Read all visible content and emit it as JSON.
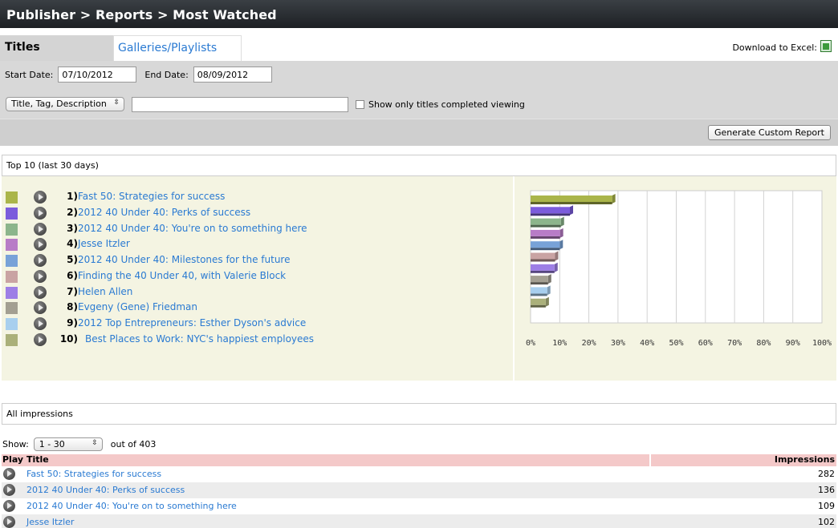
{
  "header": {
    "breadcrumb": "Publisher > Reports > Most Watched"
  },
  "tabs": {
    "titles": "Titles",
    "galleries": "Galleries/Playlists",
    "download_label": "Download to Excel:"
  },
  "filters": {
    "start_label": "Start Date:",
    "start_value": "07/10/2012",
    "end_label": "End Date:",
    "end_value": "08/09/2012",
    "search_field_select": "Title, Tag, Description",
    "search_value": "",
    "completed_label": "Show only titles completed viewing",
    "completed_checked": false,
    "generate_label": "Generate Custom Report"
  },
  "top10": {
    "heading": "Top 10 (last 30 days)",
    "items": [
      {
        "rank": "1)",
        "title": "Fast 50: Strategies for success",
        "color": "#aab54a"
      },
      {
        "rank": "2)",
        "title": "2012 40 Under 40: Perks of success",
        "color": "#7b5cdc"
      },
      {
        "rank": "3)",
        "title": "2012 40 Under 40: You're on to something here",
        "color": "#8cb58c"
      },
      {
        "rank": "4)",
        "title": "Jesse Itzler",
        "color": "#b87cc7"
      },
      {
        "rank": "5)",
        "title": "2012 40 Under 40: Milestones for the future",
        "color": "#78a2d8"
      },
      {
        "rank": "6)",
        "title": "Finding the 40 Under 40, with Valerie Block",
        "color": "#c9a3a3"
      },
      {
        "rank": "7)",
        "title": "Helen Allen",
        "color": "#9d7ee6"
      },
      {
        "rank": "8)",
        "title": "Evgeny (Gene) Friedman",
        "color": "#a39f92"
      },
      {
        "rank": "9)",
        "title": "2012 Top Entrepreneurs: Esther Dyson's advice",
        "color": "#a8cfee"
      },
      {
        "rank": "10)",
        "title": "Best Places to Work: NYC's happiest employees",
        "color": "#aab07a"
      }
    ]
  },
  "chart_data": {
    "type": "bar",
    "orientation": "horizontal",
    "categories": [
      "Fast 50: Strategies for success",
      "2012 40 Under 40: Perks of success",
      "2012 40 Under 40: You're on to something here",
      "Jesse Itzler",
      "2012 40 Under 40: Milestones for the future",
      "Finding the 40 Under 40, with Valerie Block",
      "Helen Allen",
      "Evgeny (Gene) Friedman",
      "2012 Top Entrepreneurs: Esther Dyson's advice",
      "Best Places to Work: NYC's happiest employees"
    ],
    "values": [
      28,
      13.5,
      10.4,
      10.1,
      10.0,
      8.4,
      8.2,
      6.0,
      5.7,
      5.2
    ],
    "colors": [
      "#aab54a",
      "#7b5cdc",
      "#8cb58c",
      "#b87cc7",
      "#78a2d8",
      "#c9a3a3",
      "#9d7ee6",
      "#a39f92",
      "#a8cfee",
      "#aab07a"
    ],
    "xlim": [
      0,
      100
    ],
    "xticks": [
      "0%",
      "10%",
      "20%",
      "30%",
      "40%",
      "50%",
      "60%",
      "70%",
      "80%",
      "90%",
      "100%"
    ],
    "grid": true
  },
  "impressions": {
    "heading": "All impressions",
    "show_label": "Show:",
    "show_value": "1 - 30",
    "out_of": "out of 403",
    "col_play": "Play",
    "col_title": "Title",
    "col_impressions": "Impressions",
    "rows": [
      {
        "title": "Fast 50: Strategies for success",
        "impressions": "282"
      },
      {
        "title": "2012 40 Under 40: Perks of success",
        "impressions": "136"
      },
      {
        "title": "2012 40 Under 40: You're on to something here",
        "impressions": "109"
      },
      {
        "title": "Jesse Itzler",
        "impressions": "102"
      }
    ]
  }
}
